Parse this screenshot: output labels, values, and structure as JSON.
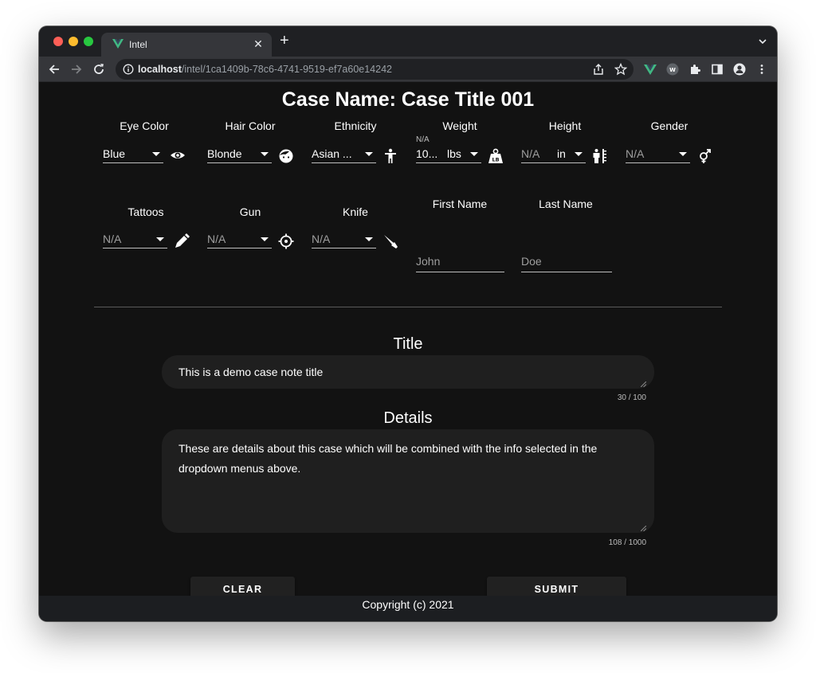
{
  "browser": {
    "tab": {
      "title": "Intel",
      "close": "✕"
    },
    "new_tab": "+",
    "url": {
      "host": "localhost",
      "path": "/intel/1ca1409b-78c6-4741-9519-ef7a60e14242"
    }
  },
  "page": {
    "case_name": "Case Name: Case Title 001",
    "fields_row1": {
      "eye_color": {
        "label": "Eye Color",
        "value": "Blue",
        "icon": "eye-icon"
      },
      "hair_color": {
        "label": "Hair Color",
        "value": "Blonde",
        "icon": "face-icon"
      },
      "ethnicity": {
        "label": "Ethnicity",
        "value": "Asian ...",
        "icon": "person-icon"
      },
      "weight": {
        "label": "Weight",
        "mini_label": "N/A",
        "value": "10...",
        "unit": "lbs",
        "icon": "weight-icon"
      },
      "height": {
        "label": "Height",
        "value": "N/A",
        "unit": "in",
        "icon": "height-icon"
      },
      "gender": {
        "label": "Gender",
        "value": "N/A",
        "icon": "gender-icon"
      }
    },
    "fields_row2": {
      "tattoos": {
        "label": "Tattoos",
        "value": "N/A",
        "icon": "tattoo-pen-icon"
      },
      "gun": {
        "label": "Gun",
        "value": "N/A",
        "icon": "crosshair-icon"
      },
      "knife": {
        "label": "Knife",
        "value": "N/A",
        "icon": "knife-icon"
      },
      "first_name": {
        "label": "First Name",
        "placeholder": "John"
      },
      "last_name": {
        "label": "Last Name",
        "placeholder": "Doe"
      }
    },
    "note": {
      "title_heading": "Title",
      "title_value": "This is a demo case note title",
      "title_counter": "30 / 100",
      "details_heading": "Details",
      "details_value": "These are details about this case which will be combined with the info selected in the dropdown menus above.",
      "details_counter": "108 / 1000"
    },
    "buttons": {
      "clear": "CLEAR",
      "submit": "SUBMIT"
    },
    "footer": "Copyright (c) 2021"
  },
  "colors": {
    "accent_vue": "#41b883",
    "page_bg": "#121212",
    "input_bg": "#1f1f1f"
  }
}
